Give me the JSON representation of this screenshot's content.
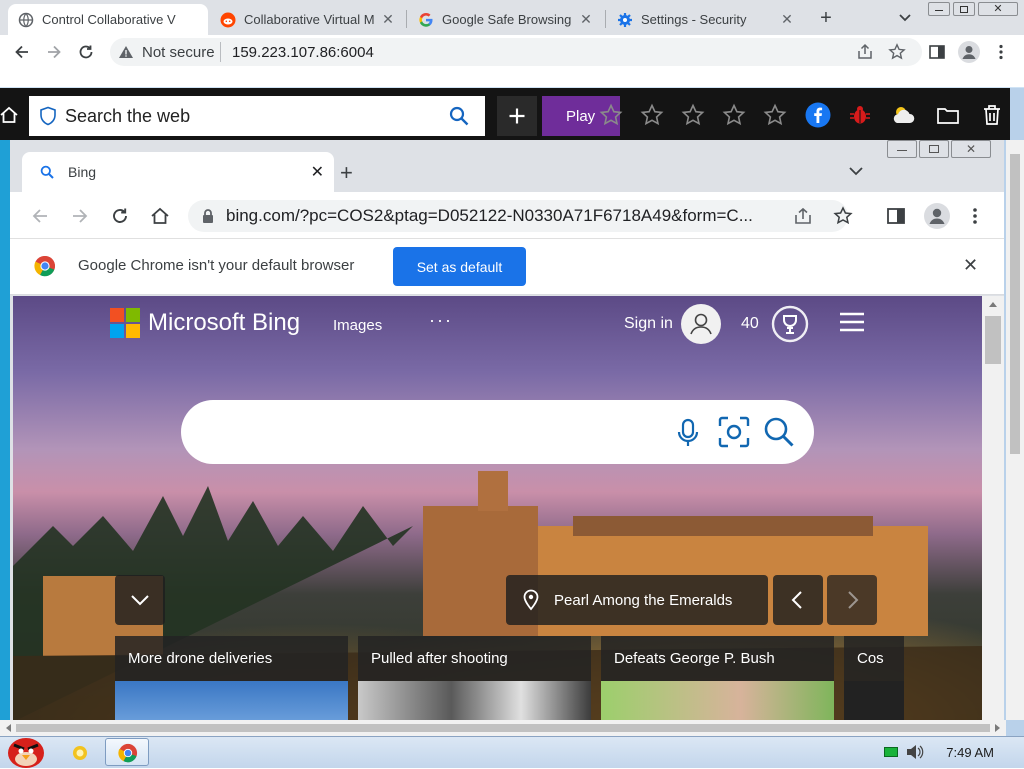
{
  "outer": {
    "tabs": [
      {
        "title": "Control Collaborative V",
        "icon": "globe-icon",
        "active": true
      },
      {
        "title": "Collaborative Virtual M",
        "icon": "reddit-icon",
        "active": false
      },
      {
        "title": "Google Safe Browsing",
        "icon": "google-icon",
        "active": false
      },
      {
        "title": "Settings - Security",
        "icon": "gear-icon",
        "active": false
      }
    ],
    "security_label": "Not secure",
    "url": "159.223.107.86:6004"
  },
  "kiosk": {
    "search_placeholder": "Search the web",
    "play_label": "Play"
  },
  "inner": {
    "tab_title": "Bing",
    "url": "bing.com/?pc=COS2&ptag=D052122-N0330A71F6718A49&form=C...",
    "infobar_message": "Google Chrome isn't your default browser",
    "set_default_label": "Set as default"
  },
  "bing": {
    "logo_text": "Microsoft Bing",
    "nav_images": "Images",
    "nav_more": "···",
    "sign_in": "Sign in",
    "rewards_points": "40",
    "caption": "Pearl Among the Emeralds",
    "news": [
      {
        "title": "More drone deliveries"
      },
      {
        "title": "Pulled after shooting"
      },
      {
        "title": "Defeats George P. Bush"
      },
      {
        "title": "Cos"
      }
    ]
  },
  "taskbar": {
    "clock": "7:49 AM"
  },
  "colors": {
    "chrome_tabbar": "#dee1e6",
    "set_default_blue": "#1a73e8",
    "play_purple": "#6f2d9a",
    "kiosk_dark": "#141414"
  }
}
